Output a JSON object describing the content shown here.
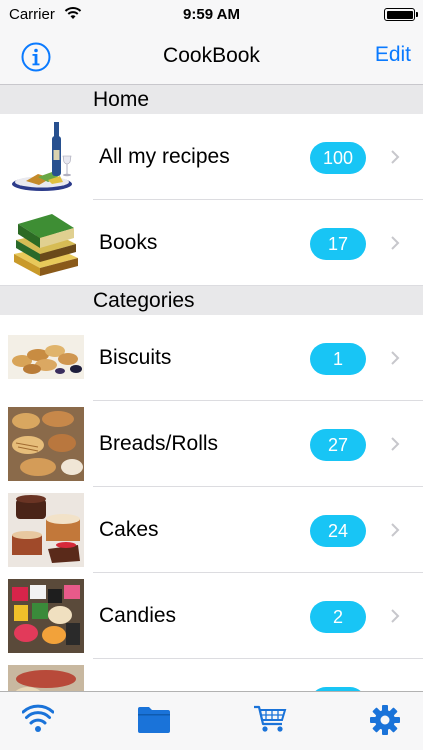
{
  "status_bar": {
    "carrier": "Carrier",
    "time": "9:59 AM"
  },
  "nav": {
    "title": "CookBook",
    "edit_label": "Edit"
  },
  "sections": [
    {
      "header": "Home",
      "rows": [
        {
          "label": "All my recipes",
          "count": "100"
        },
        {
          "label": "Books",
          "count": "17"
        }
      ]
    },
    {
      "header": "Categories",
      "rows": [
        {
          "label": "Biscuits",
          "count": "1"
        },
        {
          "label": "Breads/Rolls",
          "count": "27"
        },
        {
          "label": "Cakes",
          "count": "24"
        },
        {
          "label": "Candies",
          "count": "2"
        }
      ]
    }
  ],
  "tab_bar": {
    "icons": [
      "wifi-icon",
      "folder-icon",
      "cart-icon",
      "gear-icon"
    ]
  },
  "colors": {
    "accent": "#0a7aff",
    "badge": "#18c5f5",
    "tab_icon": "#1a73d9"
  }
}
